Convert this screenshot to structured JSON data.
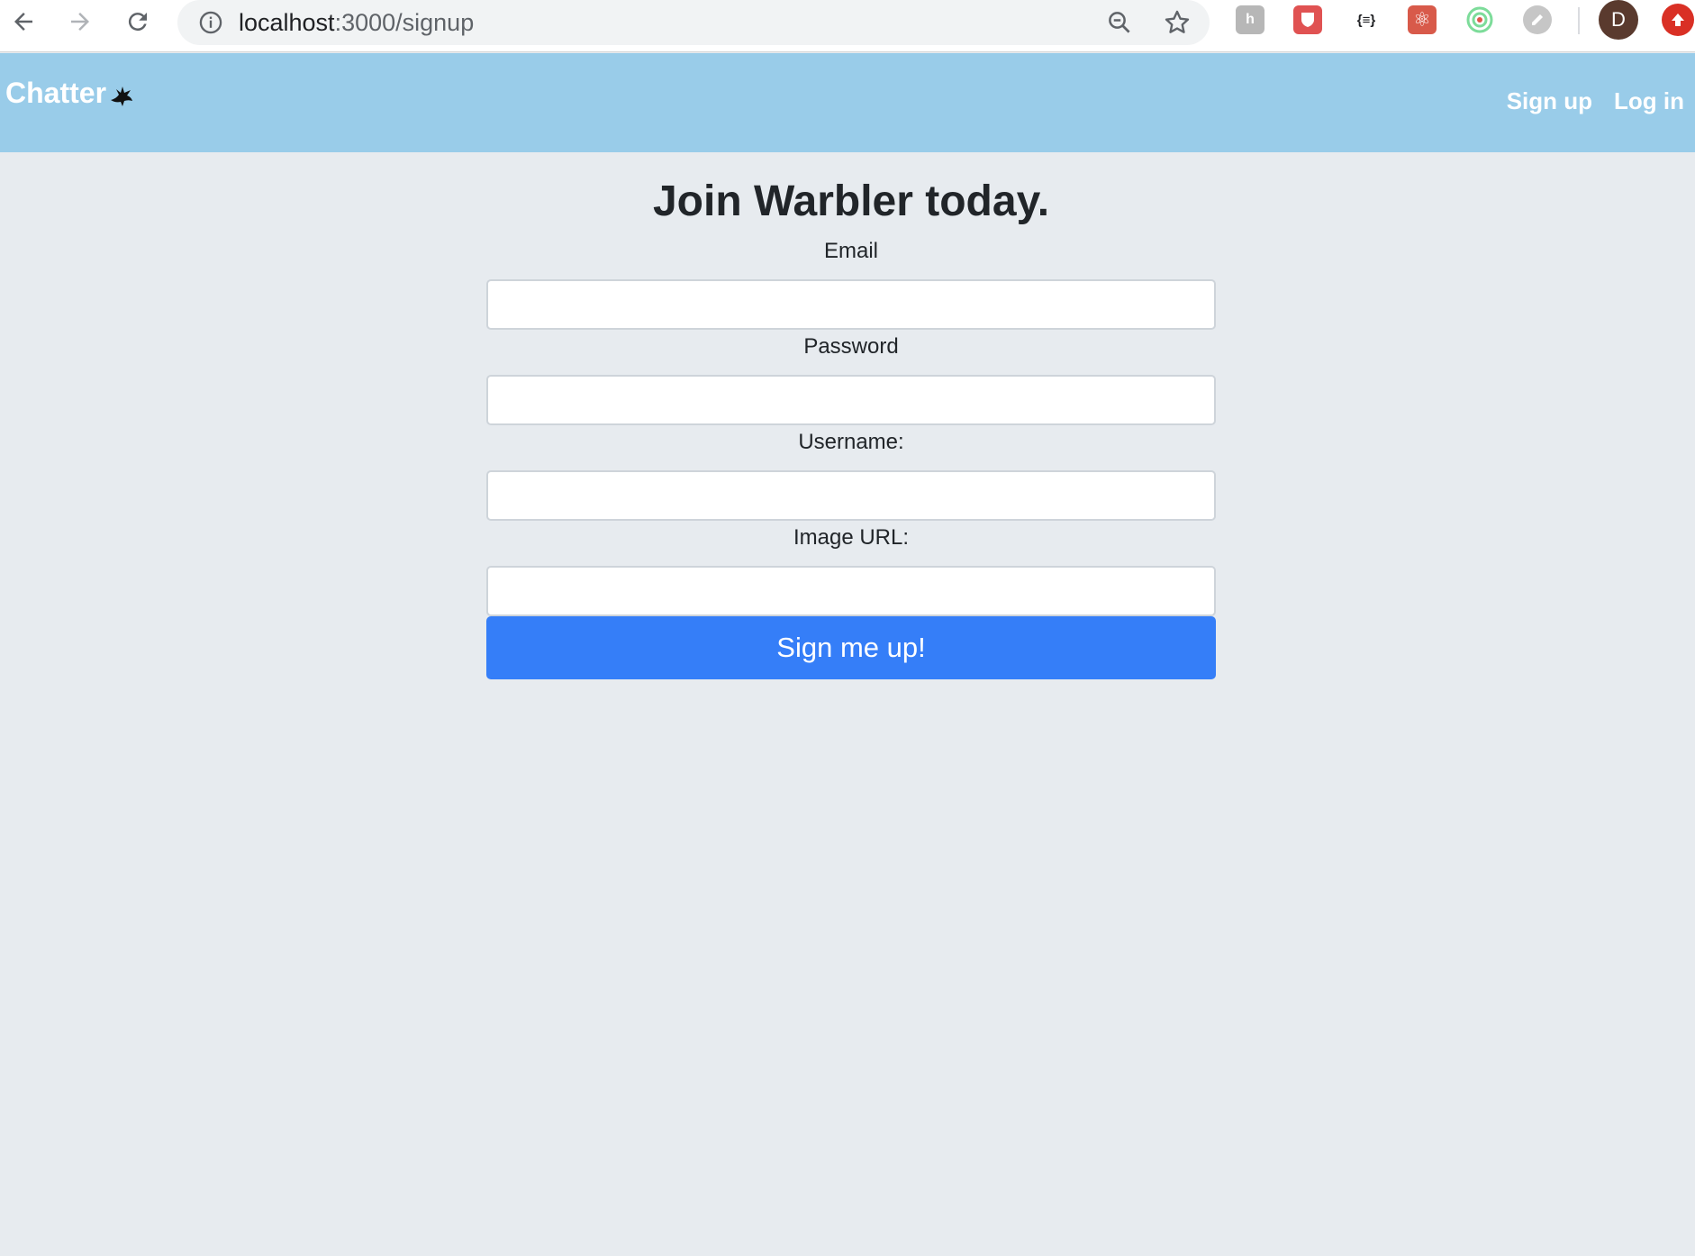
{
  "browser": {
    "url_host": "localhost",
    "url_path": ":3000/signup",
    "profile_initial": "D",
    "extensions": [
      {
        "name": "hypothesis-extension-icon",
        "glyph": "h",
        "bg": "#b7b7b7"
      },
      {
        "name": "shield-extension-icon",
        "glyph": "",
        "bg": "#e05252"
      },
      {
        "name": "json-formatter-extension-icon",
        "glyph": "{≡}",
        "bg": "transparent"
      },
      {
        "name": "react-devtools-extension-icon",
        "glyph": "⚛",
        "bg": "#d85a4a"
      },
      {
        "name": "target-extension-icon",
        "glyph": "◎",
        "bg": "transparent"
      },
      {
        "name": "link-extension-icon",
        "glyph": "⟲",
        "bg": "#cfcfcf"
      }
    ]
  },
  "navbar": {
    "brand": "Chatter",
    "links": [
      "Sign up",
      "Log in"
    ],
    "bg_color": "#99cce9"
  },
  "form": {
    "heading": "Join Warbler today.",
    "fields": [
      {
        "label": "Email",
        "value": ""
      },
      {
        "label": "Password",
        "value": ""
      },
      {
        "label": "Username:",
        "value": ""
      },
      {
        "label": "Image URL:",
        "value": ""
      }
    ],
    "submit_label": "Sign me up!",
    "submit_color": "#357ef8"
  }
}
